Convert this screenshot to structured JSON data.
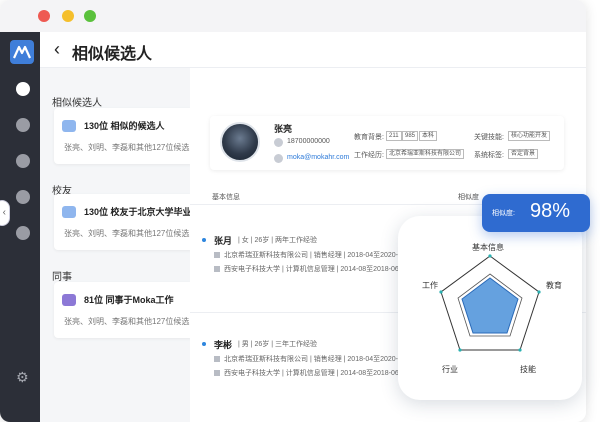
{
  "header": {
    "title": "相似候选人",
    "back_icon": "chevron-left-icon"
  },
  "sidebar": {
    "logo_icon": "moka-logo-icon",
    "settings_icon": "gear-icon"
  },
  "sections": {
    "similar": "相似候选人",
    "alumni": "校友",
    "colleagues": "同事"
  },
  "cards": [
    {
      "title": "130位 相似的候选人",
      "sub": "张亮、刘明、李磊和其他127位候选人",
      "icon_color": "#8fb6ee"
    },
    {
      "title": "130位 校友于北京大学毕业",
      "sub": "张亮、刘明、李磊和其他127位候选人",
      "icon_color": "#8fb6ee"
    },
    {
      "title": "81位 同事于Moka工作",
      "sub": "张亮、刘明、李磊和其他127位候选人",
      "icon_color": "#8c78d6"
    }
  ],
  "profile": {
    "name": "张亮",
    "phone": "18700000000",
    "email": "moka@mokahr.com",
    "edu_label": "教育背景:",
    "edu_tags": [
      "211",
      "985",
      "本科"
    ],
    "work_label": "工作经历:",
    "work_tag": "北京希瑞亚斯科技有限公司",
    "skill_label": "关键技能:",
    "skill_tag": "核心功能开发",
    "sys_label": "系统标签:",
    "sys_tag": "否定背景"
  },
  "columns": {
    "info": "基本信息",
    "similarity": "相似度"
  },
  "candidates": [
    {
      "name": "张月",
      "meta": "| 女 | 26岁 | 两年工作经验",
      "work": "北京希瑞亚斯科技有限公司 | 销售经理 | 2018-04至2020-0",
      "edu": "西安电子科技大学 | 计算机信息管理 | 2014-08至2018-06"
    },
    {
      "name": "李彬",
      "meta": "| 男 | 26岁 | 三年工作经验",
      "work": "北京希瑞亚斯科技有限公司 | 销售经理 | 2018-04至2020-06",
      "edu": "西安电子科技大学 | 计算机信息管理 | 2014-08至2018-06"
    }
  ],
  "similarity": {
    "label": "相似度:",
    "value": "98%"
  },
  "radar": {
    "axes": [
      "基本信息",
      "教育",
      "技能",
      "行业",
      "工作"
    ],
    "fill_color": "#4a90d9"
  },
  "colors": {
    "accent": "#2f6bd0",
    "sidebar": "#2c2f38"
  }
}
